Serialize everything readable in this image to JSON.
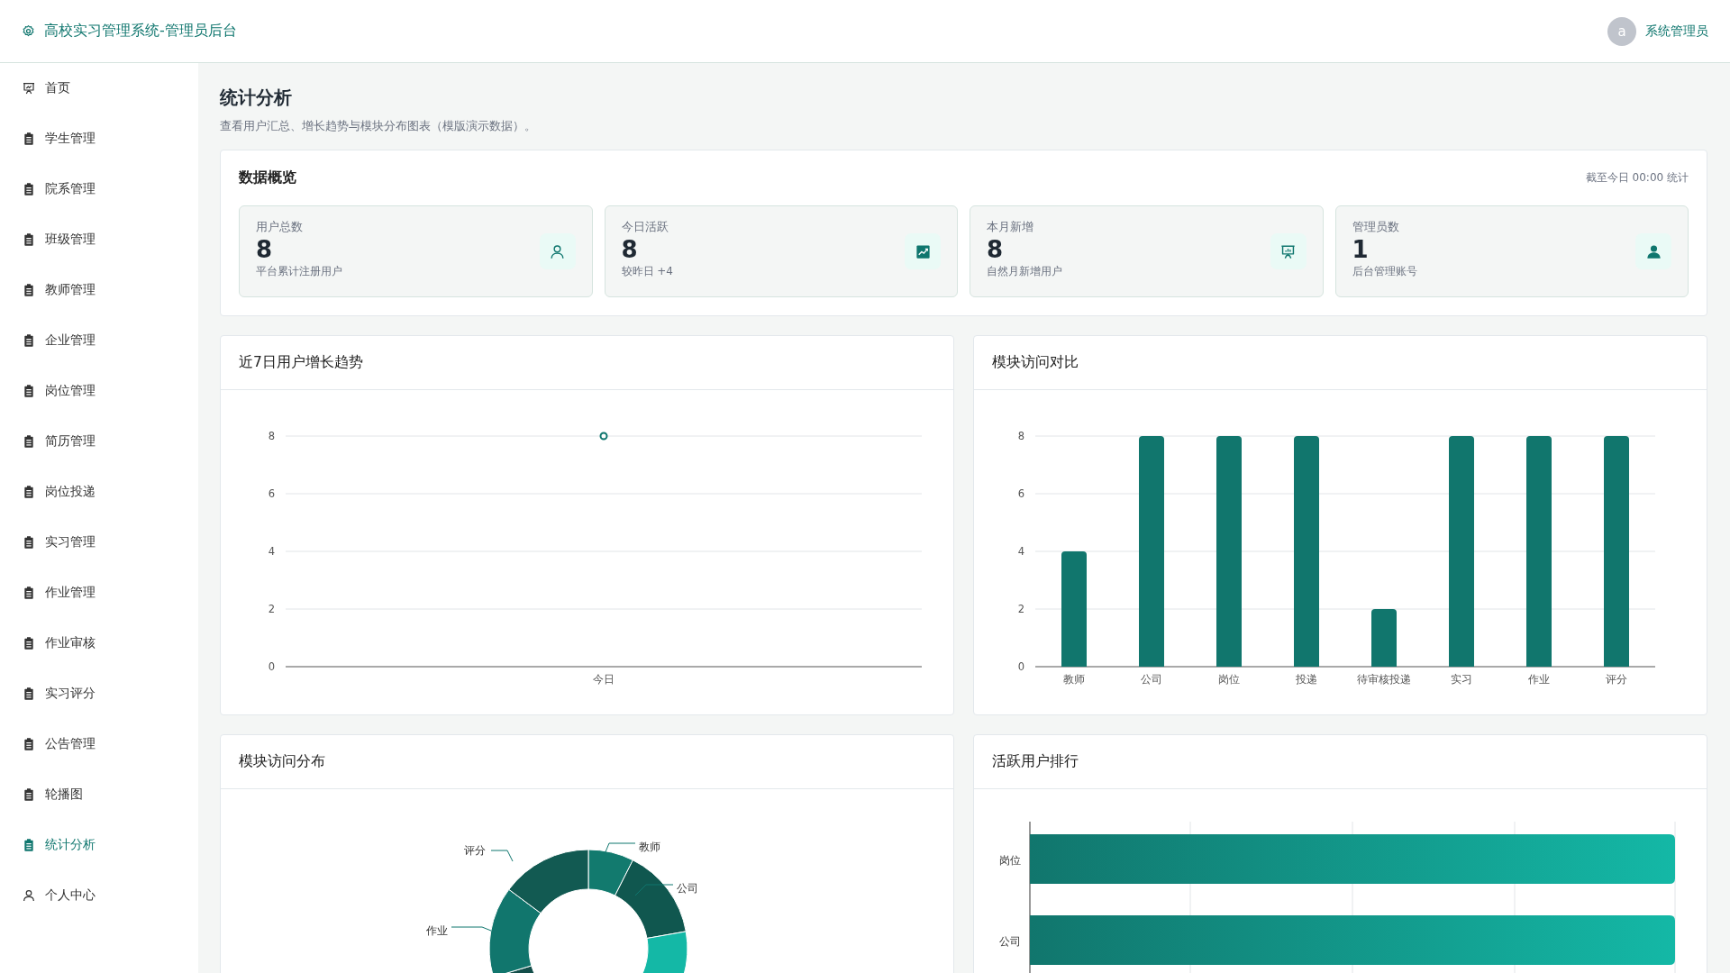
{
  "header": {
    "title": "高校实习管理系统-管理员后台",
    "user": {
      "avatar": "a",
      "name": "系统管理员"
    }
  },
  "sidebar": {
    "items": [
      {
        "label": "首页",
        "selected": false
      },
      {
        "label": "学生管理",
        "selected": false
      },
      {
        "label": "院系管理",
        "selected": false
      },
      {
        "label": "班级管理",
        "selected": false
      },
      {
        "label": "教师管理",
        "selected": false
      },
      {
        "label": "企业管理",
        "selected": false
      },
      {
        "label": "岗位管理",
        "selected": false
      },
      {
        "label": "简历管理",
        "selected": false
      },
      {
        "label": "岗位投递",
        "selected": false
      },
      {
        "label": "实习管理",
        "selected": false
      },
      {
        "label": "作业管理",
        "selected": false
      },
      {
        "label": "作业审核",
        "selected": false
      },
      {
        "label": "实习评分",
        "selected": false
      },
      {
        "label": "公告管理",
        "selected": false
      },
      {
        "label": "轮播图",
        "selected": false
      },
      {
        "label": "统计分析",
        "selected": true
      },
      {
        "label": "个人中心",
        "selected": false
      }
    ]
  },
  "page": {
    "title": "统计分析",
    "subtitle": "查看用户汇总、增长趋势与模块分布图表（模版演示数据）。"
  },
  "overview": {
    "title": "数据概览",
    "note": "截至今日 00:00 统计",
    "stats": [
      {
        "label": "用户总数",
        "value": "8",
        "caption": "平台累计注册用户"
      },
      {
        "label": "今日活跃",
        "value": "8",
        "caption": "较昨日 +4"
      },
      {
        "label": "本月新增",
        "value": "8",
        "caption": "自然月新增用户"
      },
      {
        "label": "管理员数",
        "value": "1",
        "caption": "后台管理账号"
      }
    ]
  },
  "growth": {
    "title": "近7日用户增长趋势",
    "chart_data": {
      "type": "line",
      "categories": [
        "今日"
      ],
      "series": [
        {
          "color": "#0f766e",
          "values": [
            8
          ],
          "marker": true
        }
      ],
      "grid": true,
      "ylim": [
        0,
        8
      ],
      "yticks": [
        0,
        2,
        4,
        6,
        8
      ]
    }
  },
  "comparison": {
    "title": "模块访问对比",
    "chart_data": {
      "type": "bar",
      "categories": [
        "教师",
        "公司",
        "岗位",
        "投递",
        "待审核投递",
        "实习",
        "作业",
        "评分"
      ],
      "series": [
        {
          "color": "#11766d",
          "values": [
            4,
            8,
            8,
            8,
            2,
            8,
            8,
            8
          ]
        }
      ],
      "grid": true,
      "ylim": [
        0,
        8
      ],
      "yticks": [
        0,
        2,
        4,
        6,
        8
      ]
    }
  },
  "distribution": {
    "title": "模块访问分布",
    "labels": [
      "教师",
      "公司",
      "作业",
      "评分"
    ]
  },
  "ranking": {
    "title": "活跃用户排行",
    "rows": [
      {
        "label": "岗位"
      },
      {
        "label": "公司"
      }
    ]
  }
}
